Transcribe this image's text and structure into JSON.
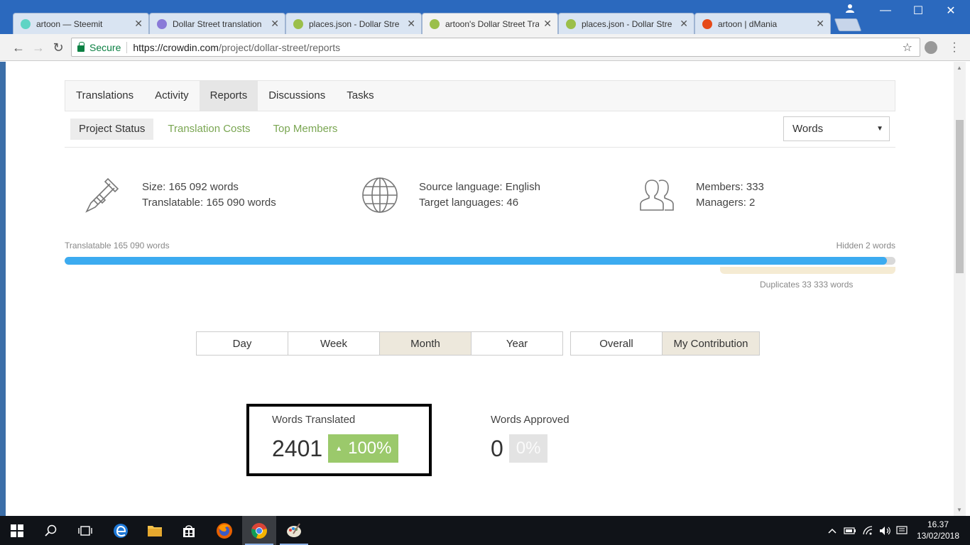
{
  "browser": {
    "tabs": [
      {
        "title": "artoon — Steemit",
        "favicon_color": "#5fd4c4",
        "active": false
      },
      {
        "title": "Dollar Street translation",
        "favicon_color": "#8a7ad8",
        "active": false
      },
      {
        "title": "places.json - Dollar Stre",
        "favicon_color": "#9bbf4a",
        "active": false
      },
      {
        "title": "artoon's Dollar Street Tra",
        "favicon_color": "#9bbf4a",
        "active": true
      },
      {
        "title": "places.json - Dollar Stre",
        "favicon_color": "#9bbf4a",
        "active": false
      },
      {
        "title": "artoon | dMania",
        "favicon_color": "#e64a19",
        "active": false
      }
    ],
    "close_glyph": "✕",
    "window_controls": {
      "minimize": "—",
      "maximize": "☐",
      "close": "✕"
    },
    "toolbar": {
      "back": "←",
      "forward": "→",
      "reload": "↻"
    },
    "address": {
      "secure_label": "Secure",
      "url_host": "https://crowdin.com",
      "url_path": "/project/dollar-street/reports",
      "star": "☆"
    }
  },
  "page": {
    "main_tabs": [
      "Translations",
      "Activity",
      "Reports",
      "Discussions",
      "Tasks"
    ],
    "active_main_tab": 2,
    "sub_tabs": [
      "Project Status",
      "Translation Costs",
      "Top Members"
    ],
    "active_sub_tab": 0,
    "unit_select": {
      "value": "Words",
      "caret": "▼"
    },
    "stats": [
      {
        "icon": "caliper-icon",
        "lines": [
          "Size: 165 092 words",
          "Translatable: 165 090 words"
        ]
      },
      {
        "icon": "globe-icon",
        "lines": [
          "Source language: English",
          "Target languages: 46"
        ]
      },
      {
        "icon": "members-icon",
        "lines": [
          "Members: 333",
          "Managers: 2"
        ]
      }
    ],
    "progress": {
      "left_label": "Translatable 165 090 words",
      "right_label": "Hidden 2 words",
      "fill_percent": 99,
      "duplicates_label": "Duplicates 33 333 words"
    },
    "period_buttons": [
      "Day",
      "Week",
      "Month",
      "Year"
    ],
    "active_period": 2,
    "scope_buttons": [
      "Overall",
      "My Contribution"
    ],
    "active_scope": 1,
    "metrics": {
      "translated": {
        "label": "Words Translated",
        "value": "2401",
        "badge": "100%",
        "arrow": "▲"
      },
      "approved": {
        "label": "Words Approved",
        "value": "0",
        "badge": "0%"
      }
    }
  },
  "taskbar": {
    "clock_time": "16.37",
    "clock_date": "13/02/2018"
  },
  "colors": {
    "accent_green": "#7aa652",
    "progress_blue": "#3cabf0",
    "badge_green": "#9bc96b",
    "chrome_blue": "#2b69be"
  }
}
